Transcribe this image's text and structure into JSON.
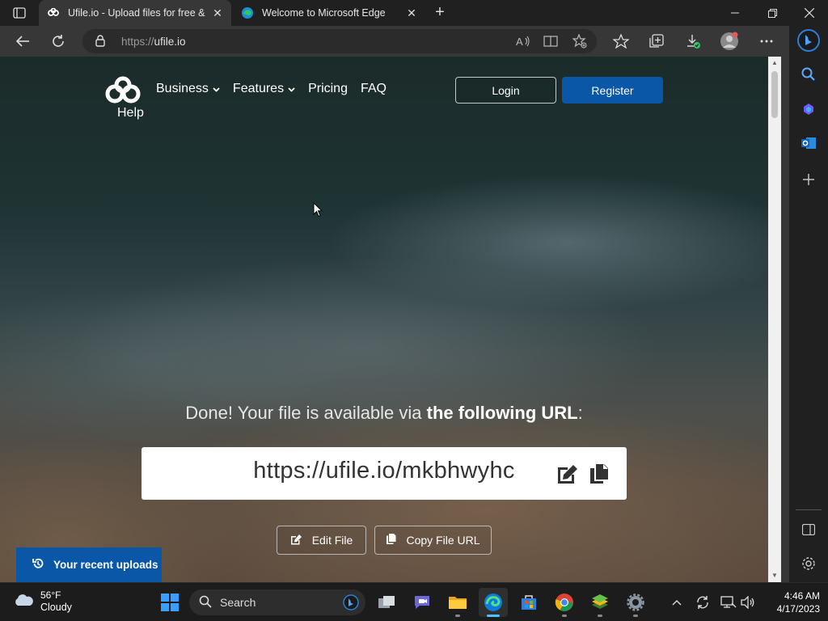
{
  "browser": {
    "tabs": [
      {
        "title": "Ufile.io - Upload files for free & s",
        "active": true
      },
      {
        "title": "Welcome to Microsoft Edge",
        "active": false
      }
    ],
    "address": {
      "protocol": "https://",
      "host": "ufile.io"
    }
  },
  "site": {
    "nav": {
      "business": "Business",
      "features": "Features",
      "pricing": "Pricing",
      "faq": "FAQ",
      "help": "Help"
    },
    "auth": {
      "login": "Login",
      "register": "Register"
    },
    "result": {
      "message_plain": "Done! Your file is available via ",
      "message_bold": "the following URL",
      "message_end": ":",
      "file_url": "https://ufile.io/mkbhwyhc"
    },
    "actions": {
      "edit": "Edit File",
      "copy": "Copy File URL"
    },
    "recent_uploads": "Your recent uploads",
    "colors": {
      "primary": "#0a57a8"
    }
  },
  "taskbar": {
    "weather": {
      "temp": "56°F",
      "condition": "Cloudy"
    },
    "search_placeholder": "Search",
    "time": "4:46 AM",
    "date": "4/17/2023"
  }
}
